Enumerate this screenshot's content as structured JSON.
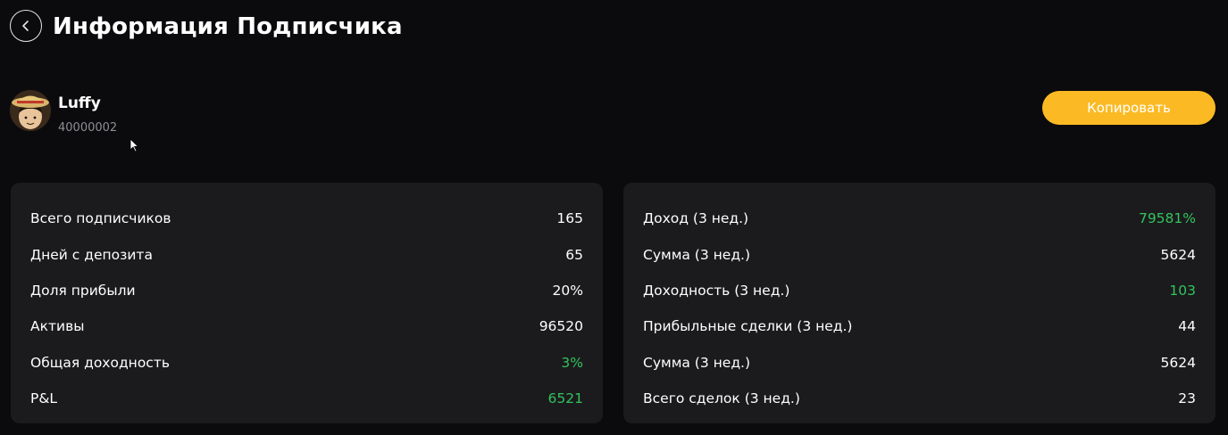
{
  "header": {
    "title": "Информация Подписчика"
  },
  "profile": {
    "name": "Luffy",
    "id": "40000002"
  },
  "actions": {
    "copy_label": "Копировать"
  },
  "left_card": {
    "rows": [
      {
        "label": "Всего подписчиков",
        "value": "165",
        "highlight": false
      },
      {
        "label": "Дней с депозита",
        "value": "65",
        "highlight": false
      },
      {
        "label": "Доля прибыли",
        "value": "20%",
        "highlight": false
      },
      {
        "label": "Активы",
        "value": "96520",
        "highlight": false
      },
      {
        "label": "Общая доходность",
        "value": "3%",
        "highlight": true
      },
      {
        "label": "P&L",
        "value": "6521",
        "highlight": true
      }
    ]
  },
  "right_card": {
    "rows": [
      {
        "label": "Доход (3 нед.)",
        "value": "79581%",
        "highlight": true
      },
      {
        "label": "Сумма (3 нед.)",
        "value": "5624",
        "highlight": false
      },
      {
        "label": "Доходность (3 нед.)",
        "value": "103",
        "highlight": true
      },
      {
        "label": "Прибыльные сделки (3 нед.)",
        "value": "44",
        "highlight": false
      },
      {
        "label": "Сумма (3 нед.)",
        "value": "5624",
        "highlight": false
      },
      {
        "label": "Всего сделок (3 нед.)",
        "value": "23",
        "highlight": false
      }
    ]
  },
  "colors": {
    "background": "#0b0b0d",
    "card": "#1b1b1e",
    "accent": "#fbba23",
    "positive": "#33c35b",
    "muted": "#8e8e93"
  },
  "icons": {
    "back": "chevron-left-icon",
    "cursor": "mouse-cursor-icon"
  }
}
